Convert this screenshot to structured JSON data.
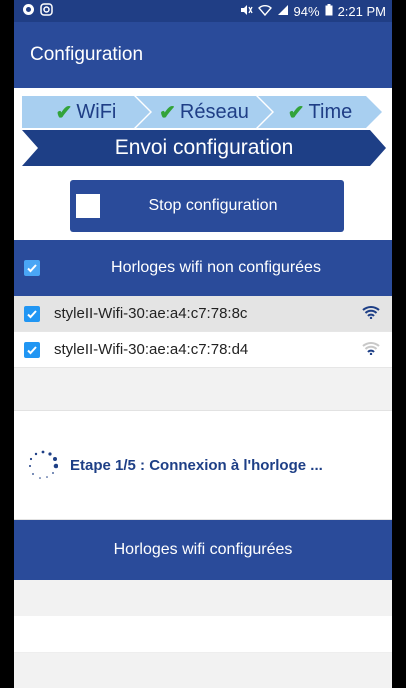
{
  "statusbar": {
    "battery": "94%",
    "time": "2:21 PM"
  },
  "appbar": {
    "title": "Configuration"
  },
  "steps": {
    "items": [
      {
        "label": "WiFi",
        "done": true
      },
      {
        "label": "Réseau",
        "done": true
      },
      {
        "label": "Time",
        "done": true
      }
    ],
    "current": "Envoi configuration"
  },
  "stop_button": {
    "label": "Stop configuration"
  },
  "unconfigured": {
    "header": "Horloges wifi non configurées",
    "devices": [
      {
        "name": "styleII-Wifi-30:ae:a4:c7:78:8c",
        "checked": true,
        "signal": "strong"
      },
      {
        "name": "styleII-Wifi-30:ae:a4:c7:78:d4",
        "checked": true,
        "signal": "weak"
      }
    ]
  },
  "progress": {
    "label": "Etape 1/5 : Connexion à l'horloge ..."
  },
  "configured": {
    "header": "Horloges wifi configurées"
  },
  "colors": {
    "primary": "#2a4b9a",
    "dark": "#1e3f86",
    "step_light": "#a8cff0",
    "check": "#33a33a"
  }
}
